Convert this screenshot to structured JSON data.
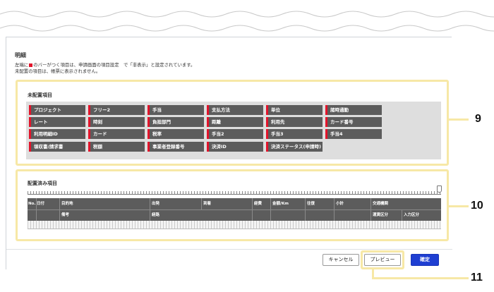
{
  "details": {
    "title": "明細",
    "note_line1_before": "左端に",
    "note_line1_after": "のバーがつく項目は、申請画面の項目設定　で「非表示」と設定されています。",
    "note_line2": "未配置の項目は、帳票に表示されません。"
  },
  "unplaced": {
    "title": "未配置項目",
    "chips": [
      "プロジェクト",
      "フリー2",
      "手当",
      "支払方法",
      "単位",
      "諸時通勤",
      "レート",
      "時刻",
      "負担部門",
      "距離",
      "利用先",
      "カード番号",
      "利用明細ID",
      "カード",
      "税率",
      "手当2",
      "手当3",
      "手当4",
      "領収書/請求書",
      "税額",
      "事業者登録番号",
      "決済ID",
      "決済ステータス(申請時)"
    ]
  },
  "placed": {
    "title": "配置済み項目",
    "headers": {
      "no": "No.",
      "date": "日付",
      "destination": "目的地",
      "departure": "出発",
      "arrival": "到着",
      "expense_type": "経費",
      "amount": "金額/Km",
      "round_trip": "往復",
      "subtotal": "小計",
      "transport": "交通機関",
      "remarks": "備考",
      "route": "経路",
      "expense_class": "運賃区分",
      "input_class": "入力区分"
    }
  },
  "footer": {
    "cancel": "キャンセル",
    "preview": "プレビュー",
    "confirm": "確定"
  },
  "callouts": {
    "unplaced": "9",
    "placed": "10",
    "preview": "11"
  },
  "colors": {
    "accent_red": "#e2142b",
    "chip_bg": "#5c5c5c",
    "confirm_blue": "#1f3fd2",
    "highlight": "#f7e8a6"
  }
}
